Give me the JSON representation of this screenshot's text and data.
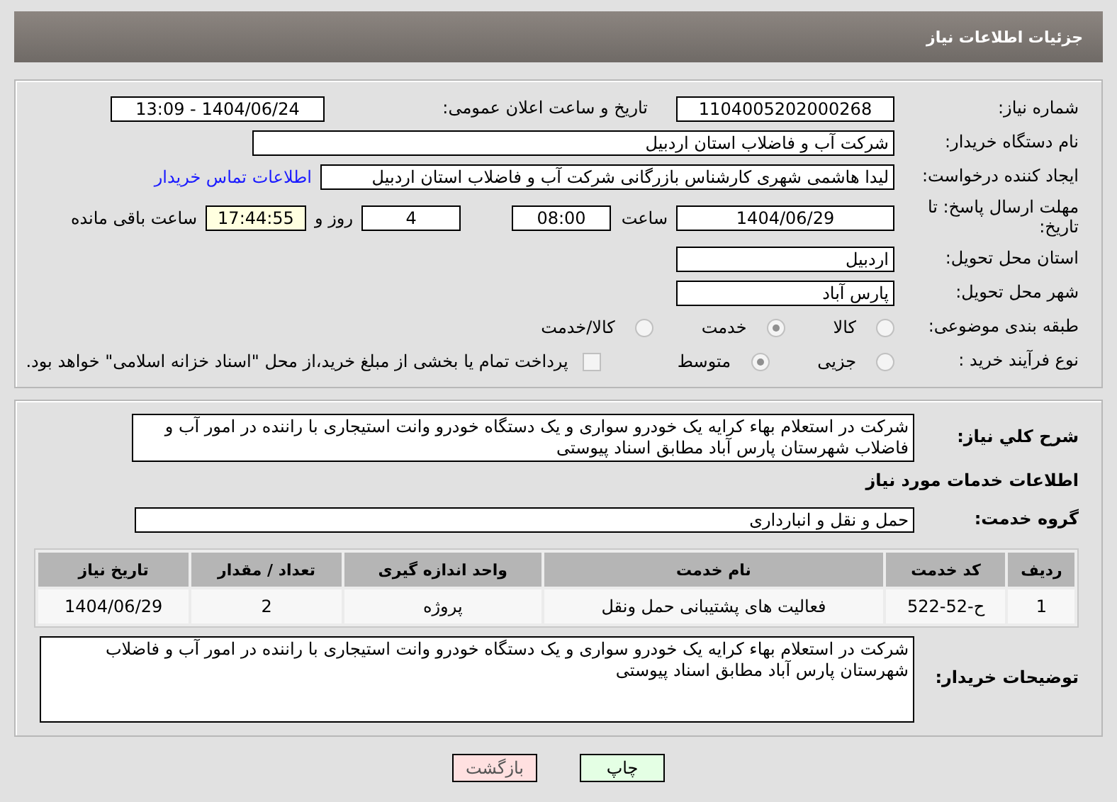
{
  "header": {
    "title": "جزئیات اطلاعات نیاز"
  },
  "need_number": {
    "label": "شماره نیاز:",
    "value": "1104005202000268"
  },
  "announce": {
    "label": "تاریخ و ساعت اعلان عمومی:",
    "value": "1404/06/24 - 13:09"
  },
  "buyer": {
    "label": "نام دستگاه خریدار:",
    "value": "شرکت آب و فاضلاب استان اردبیل"
  },
  "requester": {
    "label": "ایجاد کننده درخواست:",
    "value": "لیدا  هاشمی شهری کارشناس بازرگانی شرکت آب و فاضلاب استان اردبیل",
    "link": "اطلاعات تماس خریدار"
  },
  "deadline": {
    "label": "مهلت ارسال پاسخ: تا تاریخ:",
    "date": "1404/06/29",
    "time_label": "ساعت",
    "time": "08:00",
    "days": "4",
    "days_label": "روز و",
    "remaining": "17:44:55",
    "remaining_label": "ساعت باقی مانده"
  },
  "province": {
    "label": "استان محل تحویل:",
    "value": "اردبیل"
  },
  "city": {
    "label": "شهر محل تحویل:",
    "value": "پارس آباد"
  },
  "category": {
    "label": "طبقه بندی موضوعی:",
    "options": [
      {
        "label": "کالا",
        "selected": false
      },
      {
        "label": "خدمت",
        "selected": true
      },
      {
        "label": "کالا/خدمت",
        "selected": false
      }
    ]
  },
  "process": {
    "label": "نوع فرآیند خرید :",
    "options": [
      {
        "label": "جزیی",
        "selected": false
      },
      {
        "label": "متوسط",
        "selected": true
      }
    ],
    "payment": {
      "checked": false,
      "text": "پرداخت تمام یا بخشی از مبلغ خرید،از محل \"اسناد خزانه اسلامی\" خواهد بود."
    }
  },
  "description": {
    "label": "شرح کلي نياز:",
    "value": "شرکت در استعلام بهاء کرایه یک خودرو سواری و یک دستگاه خودرو وانت استیجاری با راننده در امور آب و فاضلاب شهرستان پارس آباد مطابق اسناد پیوستی"
  },
  "services_heading": "اطلاعات خدمات مورد نیاز",
  "service_group": {
    "label": "گروه خدمت:",
    "value": "حمل و نقل و انبارداری"
  },
  "table": {
    "columns": [
      "ردیف",
      "کد خدمت",
      "نام خدمت",
      "واحد اندازه گیری",
      "تعداد / مقدار",
      "تاریخ نیاز"
    ],
    "rows": [
      [
        "1",
        "ح-52-522",
        "فعالیت های پشتیبانی حمل ونقل",
        "پروژه",
        "2",
        "1404/06/29"
      ]
    ]
  },
  "buyer_notes": {
    "label": "توضیحات خریدار:",
    "value": "شرکت در استعلام بهاء کرایه یک خودرو سواری و یک دستگاه خودرو وانت استیجاری با راننده در امور آب و فاضلاب شهرستان پارس آباد مطابق اسناد پیوستی"
  },
  "buttons": [
    {
      "label": "چاپ",
      "kind": "print"
    },
    {
      "label": "بازگشت",
      "kind": "back"
    }
  ]
}
